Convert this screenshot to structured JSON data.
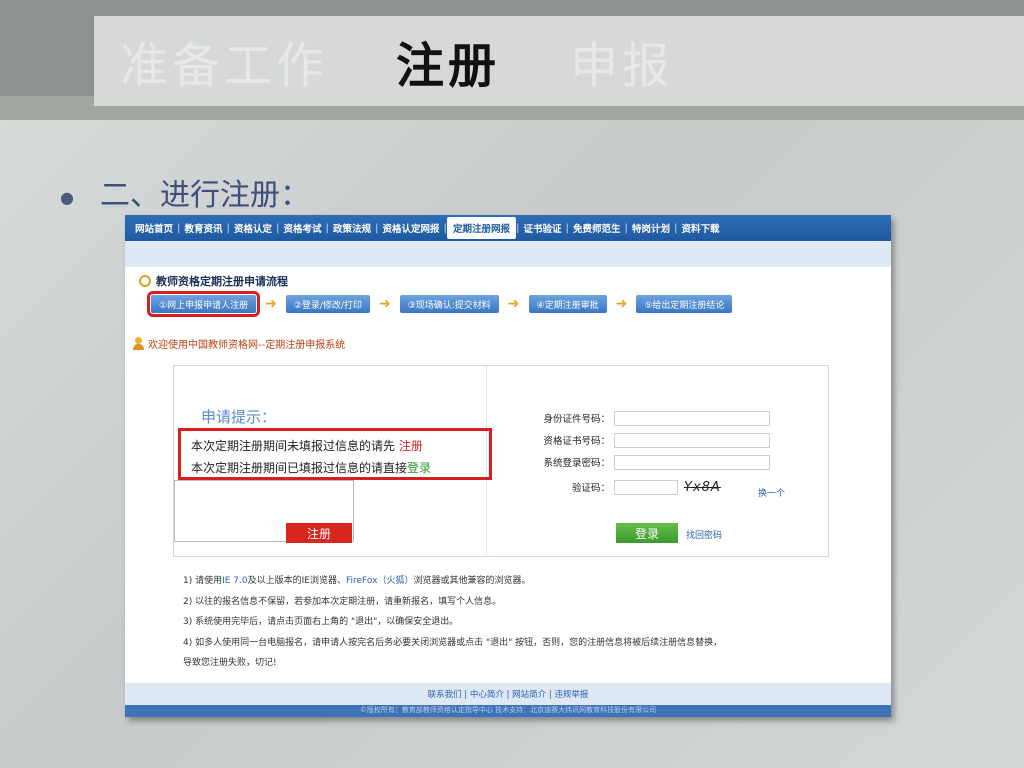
{
  "slide": {
    "tabs": [
      "准备工作",
      "注册",
      "申报"
    ],
    "bullet": "二、进行注册："
  },
  "nav": {
    "items": [
      "网站首页",
      "教育资讯",
      "资格认定",
      "资格考试",
      "政策法规",
      "资格认定网报",
      "定期注册网报",
      "证书验证",
      "免费师范生",
      "特岗计划",
      "资料下载"
    ],
    "current_index": 6
  },
  "process": {
    "title": "教师资格定期注册申请流程",
    "steps": [
      "①网上申报申请人注册",
      "②登录/修改/打印",
      "③现场确认:提交材料",
      "④定期注册审批",
      "⑤给出定期注册结论"
    ]
  },
  "welcome": "欢迎使用中国教师资格网--定期注册申报系统",
  "hint": {
    "title": "申请提示：",
    "line1_text": "本次定期注册期间未填报过信息的请先",
    "line1_link": "注册",
    "line2_text": "本次定期注册期间已填报过信息的请直接",
    "line2_link": "登录",
    "register_button": "注册"
  },
  "form": {
    "id_label": "身份证件号码：",
    "cert_label": "资格证书号码：",
    "password_label": "系统登录密码：",
    "captcha_label": "验证码：",
    "captcha_image_text": "Yx8A",
    "refresh_link": "换一个",
    "login_button": "登录",
    "forgot_link": "找回密码"
  },
  "notes": {
    "n1_a": "1) 请使用",
    "n1_b": "IE 7.0",
    "n1_c": "及以上版本的IE浏览器、",
    "n1_d": "FireFox（火狐）",
    "n1_e": "浏览器或其他兼容的浏览器。",
    "n2": "2) 以往的报名信息不保留，若参加本次定期注册，请重新报名，填写个人信息。",
    "n3": "3) 系统使用完毕后，请点击页面右上角的 \"退出\"，以确保安全退出。",
    "n4": "4) 如多人使用同一台电脑报名，请申请人按完名后务必要关闭浏览器或点击 \"退出\" 按钮，否则，您的注册信息将被后续注册信息替换，",
    "n4b": "导致您注册失败，切记!"
  },
  "footer": {
    "links": "联系我们 | 中心简介 | 网站简介 | 违规举报",
    "cut": "©版权所有：教育部教师资格认定指导中心 技术支持：北京迪赛大纬讯网教育科技股份有限公司"
  }
}
